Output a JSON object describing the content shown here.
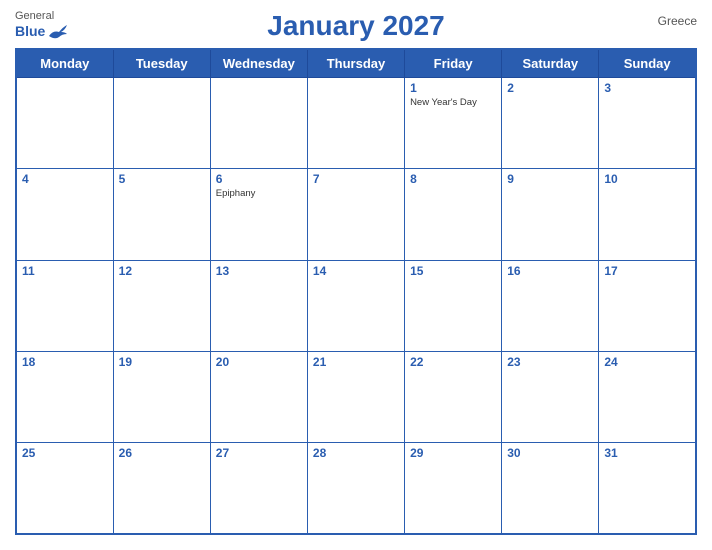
{
  "header": {
    "title": "January 2027",
    "country": "Greece",
    "logo": {
      "general": "General",
      "blue": "Blue"
    }
  },
  "weekdays": [
    "Monday",
    "Tuesday",
    "Wednesday",
    "Thursday",
    "Friday",
    "Saturday",
    "Sunday"
  ],
  "weeks": [
    [
      {
        "day": "",
        "empty": true
      },
      {
        "day": "",
        "empty": true
      },
      {
        "day": "",
        "empty": true
      },
      {
        "day": "",
        "empty": true
      },
      {
        "day": "1",
        "holiday": "New Year's Day"
      },
      {
        "day": "2"
      },
      {
        "day": "3"
      }
    ],
    [
      {
        "day": "4"
      },
      {
        "day": "5"
      },
      {
        "day": "6",
        "holiday": "Epiphany"
      },
      {
        "day": "7"
      },
      {
        "day": "8"
      },
      {
        "day": "9"
      },
      {
        "day": "10"
      }
    ],
    [
      {
        "day": "11"
      },
      {
        "day": "12"
      },
      {
        "day": "13"
      },
      {
        "day": "14"
      },
      {
        "day": "15"
      },
      {
        "day": "16"
      },
      {
        "day": "17"
      }
    ],
    [
      {
        "day": "18"
      },
      {
        "day": "19"
      },
      {
        "day": "20"
      },
      {
        "day": "21"
      },
      {
        "day": "22"
      },
      {
        "day": "23"
      },
      {
        "day": "24"
      }
    ],
    [
      {
        "day": "25"
      },
      {
        "day": "26"
      },
      {
        "day": "27"
      },
      {
        "day": "28"
      },
      {
        "day": "29"
      },
      {
        "day": "30"
      },
      {
        "day": "31"
      }
    ]
  ]
}
